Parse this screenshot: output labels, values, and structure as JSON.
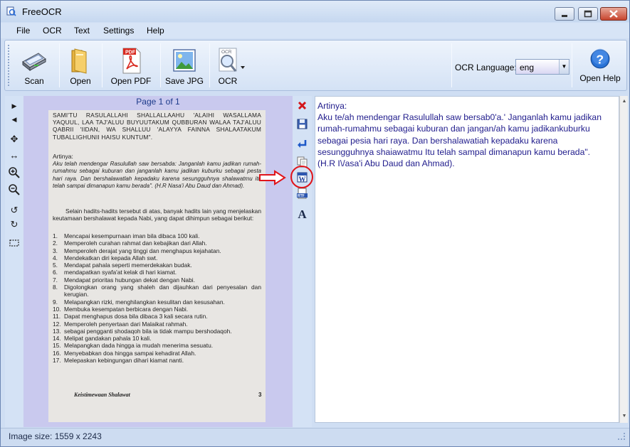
{
  "window": {
    "title": "FreeOCR"
  },
  "menu": {
    "items": [
      "File",
      "OCR",
      "Text",
      "Settings",
      "Help"
    ]
  },
  "toolbar": {
    "buttons": [
      {
        "label": "Scan",
        "icon": "scanner-icon"
      },
      {
        "label": "Open",
        "icon": "folder-icon"
      },
      {
        "label": "Open PDF",
        "icon": "pdf-icon"
      },
      {
        "label": "Save JPG",
        "icon": "image-icon"
      },
      {
        "label": "OCR",
        "icon": "ocr-magnifier-icon"
      }
    ],
    "pdf_icon_text": "PDF",
    "ocr_icon_text": "OCR",
    "ocr_language_label": "OCR Language:",
    "ocr_language_value": "eng",
    "help_label": "Open Help"
  },
  "viewer": {
    "page_indicator": "Page 1 of 1",
    "document": {
      "arabic": "SAMI'TU RASULALLAHI SHALLALLAAHU 'ALAIHI WASALLAMA YAQUUL, LAA TAJ'ALUU BUYUUTAKUM QUBBURAN WALAA TAJ'ALUU QABRII 'IIDAN, WA SHALLUU 'ALAYYA FAINNA SHALAATAKUM TUBALLIGHUNII HAISU KUNTUM\".",
      "artinya_label": "Artinya:",
      "artinya_text": "Aku telah mendengar Rasulullah saw bersabda: Janganlah kamu jadikan rumah-rumahmu sebagai kuburan dan janganlah kamu jadikan kuburku sebagai pesta hari raya. Dan bershalawatlah kepadaku karena sesungguhnya shalawatmu itu telah sampai dimanapun kamu berada\". (H.R Nasa'i Abu Daud dan Ahmad).",
      "paragraph": "Selain hadits-hadits tersebut di atas, banyak hadits lain yang menjelaskan keutamaan bershalawat kepada Nabi, yang dapat dihimpun sebagai berikut:",
      "list": [
        {
          "n": "1.",
          "t": "Mencapai kesempurnaan iman bila dibaca 100 kali."
        },
        {
          "n": "2.",
          "t": "Memperoleh curahan rahmat dan kebajikan dari Allah."
        },
        {
          "n": "3.",
          "t": "Memperoleh derajat yang tinggi dan menghapus kejahatan."
        },
        {
          "n": "4.",
          "t": "Mendekatkan diri kepada Allah swt."
        },
        {
          "n": "5.",
          "t": "Mendapat pahala seperti memerdekakan budak."
        },
        {
          "n": "6.",
          "t": "mendapatkan syafa'at kelak di hari kiamat."
        },
        {
          "n": "7.",
          "t": "Mendapat prioritas hubungan dekat dengan Nabi."
        },
        {
          "n": "8.",
          "t": "Digolongkan orang yang shaleh dan dijauhkan dari penyesalan dan kerugian."
        },
        {
          "n": "9.",
          "t": "Melapangkan rizki, menghilangkan kesulitan dan kesusahan."
        },
        {
          "n": "10.",
          "t": "Membuka kesempatan berbicara dengan Nabi."
        },
        {
          "n": "11.",
          "t": "Dapat menghapus dosa bila dibaca 3 kali secara rutin."
        },
        {
          "n": "12.",
          "t": "Memperoleh penyertaan dari Malaikat rahmah."
        },
        {
          "n": "13.",
          "t": "sebagai pengganti shodaqoh bila ia tidak mampu bershodaqoh."
        },
        {
          "n": "14.",
          "t": "Melipat gandakan pahala 10 kali."
        },
        {
          "n": "15.",
          "t": "Melapangkan dada hingga ia mudah menerima sesuatu."
        },
        {
          "n": "16.",
          "t": "Menyebabkan doa hingga sampai kehadirat Allah."
        },
        {
          "n": "17.",
          "t": "Melepaskan kebingungan dihari kiamat nanti."
        }
      ],
      "footer_title": "Keistimewaan Shalawat",
      "footer_page": "3"
    }
  },
  "ocr_output": {
    "text": "Artinya:\nAku te/ah mendengar Rasulullah saw bersab0'a.' Janganlah kamu jadikan rumah-rumahmu sebagai kuburan dan jangan/ah kamu jadikankuburku sebagai pesia hari raya. Dan bershalawatiah kepadaku karena sesungguhnya shaiawatmu Itu telah sampal dimanapun kamu berada\". (H.R I\\/asa'i Abu Daud dan Ahmad)."
  },
  "status": {
    "image_size": "Image size:  1559 x  2243"
  },
  "colors": {
    "accent_red": "#e0141a",
    "ocr_text_color": "#201c8c",
    "viewer_background": "#c9c9ee"
  }
}
